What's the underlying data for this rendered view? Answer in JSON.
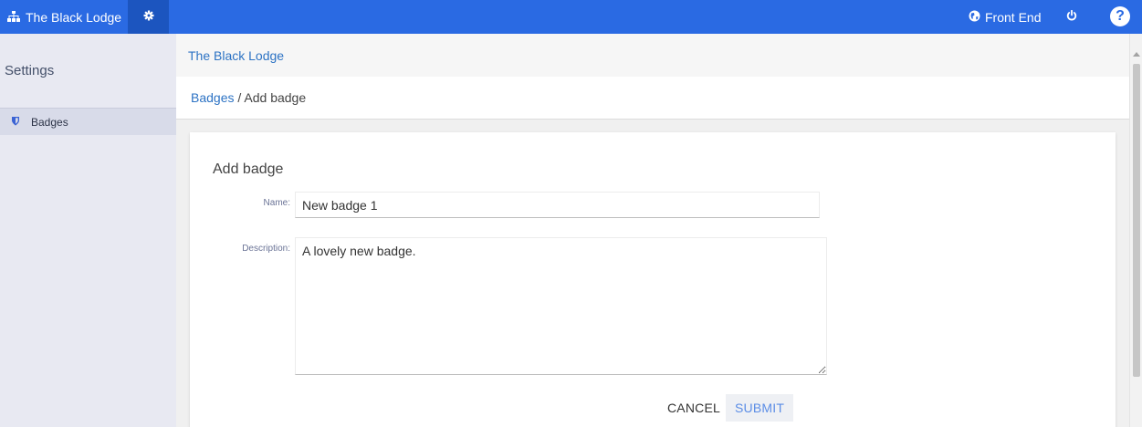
{
  "topbar": {
    "site_name": "The Black Lodge",
    "front_end_label": "Front End",
    "help_glyph": "?",
    "icons": [
      "sitemap-icon",
      "gear-icon",
      "globe-icon",
      "power-icon",
      "help-icon"
    ],
    "accent_color": "#2a6ae3"
  },
  "sidebar": {
    "title": "Settings",
    "items": [
      {
        "label": "Badges",
        "icon": "shield-icon",
        "active": true
      }
    ]
  },
  "header": {
    "site_title": "The Black Lodge"
  },
  "breadcrumb": {
    "parent": "Badges",
    "separator": " / ",
    "current": "Add badge"
  },
  "form": {
    "title": "Add badge",
    "name_label": "Name:",
    "name_value": "New badge 1",
    "description_label": "Description:",
    "description_value": "A lovely new badge.",
    "cancel_label": "CANCEL",
    "submit_label": "SUBMIT"
  }
}
